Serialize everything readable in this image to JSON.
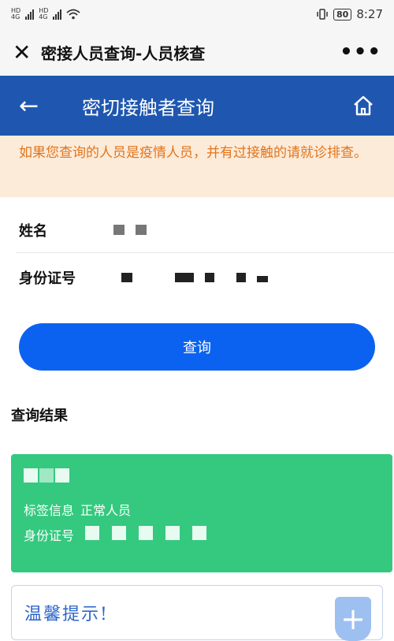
{
  "status_bar": {
    "hd1": "HD",
    "net1": "4G",
    "hd2": "HD",
    "net2": "4G",
    "battery": "80",
    "time": "8:27"
  },
  "titlebar": {
    "close_icon": "close-icon",
    "title": "密接人员查询-人员核查",
    "more_icon": "more-icon"
  },
  "header": {
    "back_icon": "back-arrow-icon",
    "title": "密切接触者查询",
    "home_icon": "home-icon"
  },
  "notice": {
    "text": "如果您查询的人员是疫情人员，并有过接触的请就诊排查。"
  },
  "form": {
    "name_label": "姓名",
    "id_label": "身份证号"
  },
  "query_button": "查询",
  "result": {
    "section_title": "查询结果",
    "tag_label": "标签信息",
    "tag_value": "正常人员",
    "id_label": "身份证号"
  },
  "tips": {
    "title": "温馨提示!",
    "icon": "plus-shield-icon"
  },
  "colors": {
    "header": "#1f57b0",
    "button": "#0c62f0",
    "card": "#34c97f",
    "notice_text": "#e0751d"
  }
}
